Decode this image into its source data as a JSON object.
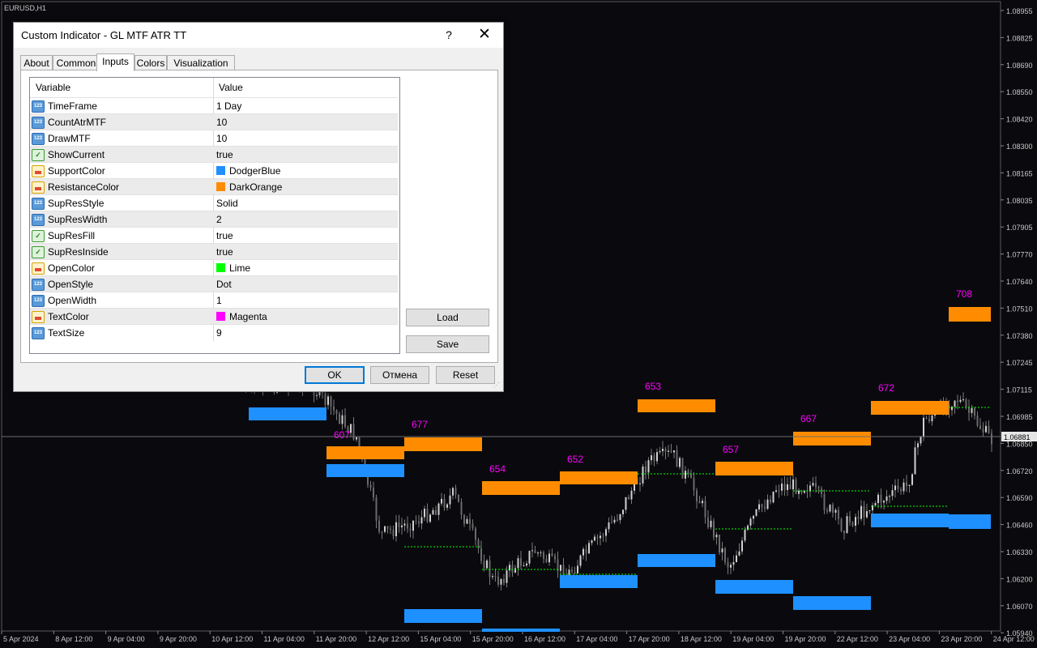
{
  "chart": {
    "symbol_label": "EURUSD,H1",
    "price_ticks": [
      "1.08955",
      "1.08825",
      "1.08690",
      "1.08550",
      "1.08420",
      "1.08300",
      "1.08165",
      "1.08035",
      "1.07905",
      "1.07770",
      "1.07640",
      "1.07510",
      "1.07380",
      "1.07245",
      "1.07115",
      "1.06985",
      "1.06850",
      "1.06720",
      "1.06590",
      "1.06460",
      "1.06330",
      "1.06200",
      "1.06070",
      "1.05940"
    ],
    "current_price": "1.06881",
    "time_ticks": [
      "5 Apr 2024",
      "8 Apr 12:00",
      "9 Apr 04:00",
      "9 Apr 20:00",
      "10 Apr 12:00",
      "11 Apr 04:00",
      "11 Apr 20:00",
      "12 Apr 12:00",
      "15 Apr 04:00",
      "15 Apr 20:00",
      "16 Apr 12:00",
      "17 Apr 04:00",
      "17 Apr 20:00",
      "18 Apr 12:00",
      "19 Apr 04:00",
      "19 Apr 20:00",
      "22 Apr 12:00",
      "23 Apr 04:00",
      "23 Apr 20:00",
      "24 Apr 12:00"
    ],
    "atr_labels": [
      "607",
      "677",
      "654",
      "652",
      "653",
      "657",
      "667",
      "672",
      "708"
    ],
    "colors": {
      "background": "#0a0a0e",
      "support": "#1e90ff",
      "resistance": "#ff8c00",
      "open_line": "#00ff00",
      "text": "#ff00ff",
      "axis_text": "#c8c8c8"
    }
  },
  "dialog": {
    "title": "Custom Indicator - GL MTF ATR TT",
    "help_label": "?",
    "close_label": "✕",
    "tabs": [
      "About",
      "Common",
      "Inputs",
      "Colors",
      "Visualization"
    ],
    "active_tab": "Inputs",
    "header": {
      "variable": "Variable",
      "value": "Value"
    },
    "params": [
      {
        "name": "TimeFrame",
        "value": "1 Day",
        "icon": "number-icon"
      },
      {
        "name": "CountAtrMTF",
        "value": "10",
        "icon": "number-icon"
      },
      {
        "name": "DrawMTF",
        "value": "10",
        "icon": "number-icon"
      },
      {
        "name": "ShowCurrent",
        "value": "true",
        "icon": "bool-icon"
      },
      {
        "name": "SupportColor",
        "value": "DodgerBlue",
        "icon": "color-icon",
        "swatch": "#1e90ff"
      },
      {
        "name": "ResistanceColor",
        "value": "DarkOrange",
        "icon": "color-icon",
        "swatch": "#ff8c00"
      },
      {
        "name": "SupResStyle",
        "value": "Solid",
        "icon": "number-icon"
      },
      {
        "name": "SupResWidth",
        "value": "2",
        "icon": "number-icon"
      },
      {
        "name": "SupResFill",
        "value": "true",
        "icon": "bool-icon"
      },
      {
        "name": "SupResInside",
        "value": "true",
        "icon": "bool-icon"
      },
      {
        "name": "OpenColor",
        "value": "Lime",
        "icon": "color-icon",
        "swatch": "#00ff00"
      },
      {
        "name": "OpenStyle",
        "value": "Dot",
        "icon": "number-icon"
      },
      {
        "name": "OpenWidth",
        "value": "1",
        "icon": "number-icon"
      },
      {
        "name": "TextColor",
        "value": "Magenta",
        "icon": "color-icon",
        "swatch": "#ff00ff"
      },
      {
        "name": "TextSize",
        "value": "9",
        "icon": "number-icon"
      }
    ],
    "side_buttons": {
      "load": "Load",
      "save": "Save"
    },
    "footer_buttons": {
      "ok": "OK",
      "cancel": "Отмена",
      "reset": "Reset"
    }
  }
}
